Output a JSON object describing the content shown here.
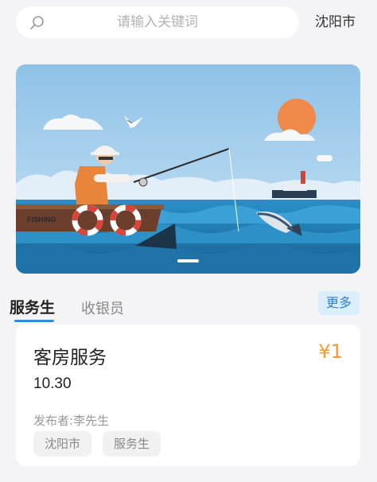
{
  "search": {
    "placeholder": "请输入关键词"
  },
  "location": {
    "city": "沈阳市"
  },
  "banner": {
    "boat_text": "FISHING",
    "active_slide": 1
  },
  "tabs": [
    {
      "label": "服务生",
      "active": true
    },
    {
      "label": "收银员",
      "active": false
    }
  ],
  "more_label": "更多",
  "listing": {
    "title": "客房服务",
    "price": "¥1",
    "date": "10.30",
    "publisher_label": "发布者:",
    "publisher_name": "李先生",
    "tags": [
      "沈阳市",
      "服务生"
    ]
  },
  "colors": {
    "accent": "#2b8de0",
    "price": "#f39a3c",
    "background": "#f4f4f6"
  }
}
